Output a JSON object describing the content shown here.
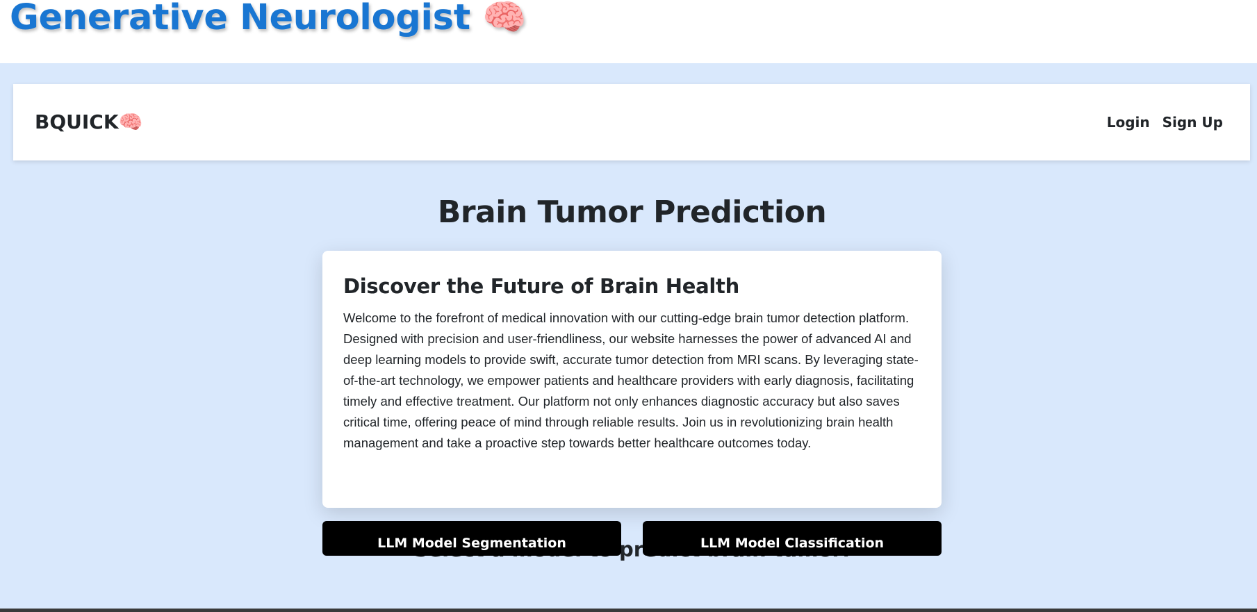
{
  "header": {
    "app_title": "Generative Neurologist",
    "app_emoji": "🧠"
  },
  "navbar": {
    "brand": "BQUICK",
    "brand_emoji": "🧠",
    "login_label": "Login",
    "signup_label": "Sign Up"
  },
  "main": {
    "page_title": "Brain Tumor Prediction",
    "card": {
      "title": "Discover the Future of Brain Health",
      "body": "Welcome to the forefront of medical innovation with our cutting-edge brain tumor detection platform. Designed with precision and user-friendliness, our website harnesses the power of advanced AI and deep learning models to provide swift, accurate tumor detection from MRI scans. By leveraging state-of-the-art technology, we empower patients and healthcare providers with early diagnosis, facilitating timely and effective treatment. Our platform not only enhances diagnostic accuracy but also saves critical time, offering peace of mind through reliable results. Join us in revolutionizing brain health management and take a proactive step towards better healthcare outcomes today."
    },
    "select_heading": "Select a model to predict brain tumor:",
    "buttons": {
      "segmentation": "LLM Model Segmentation",
      "classification": "LLM Model Classification"
    }
  },
  "colors": {
    "title_blue": "#1976d2",
    "background": "#d9e8fc",
    "button_black": "#000000"
  }
}
